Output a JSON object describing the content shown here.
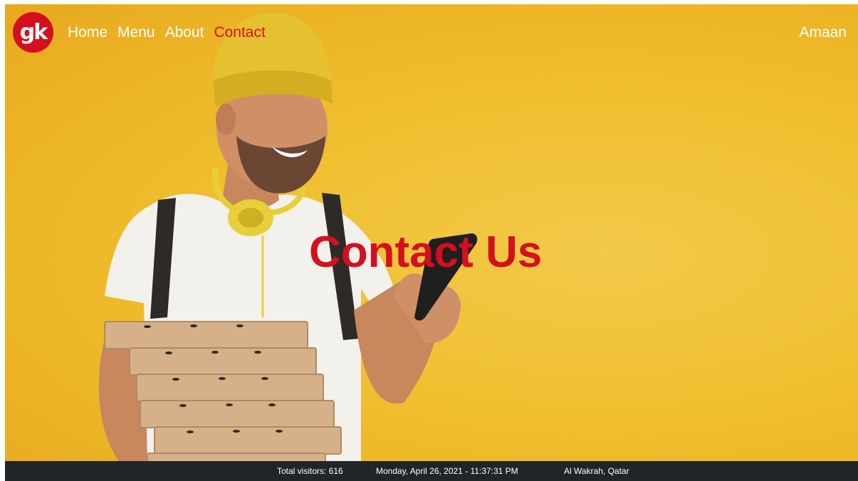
{
  "brand": {
    "logo_text": "gk",
    "logo_color": "#d4101e"
  },
  "nav": {
    "items": [
      {
        "label": "Home",
        "active": false
      },
      {
        "label": "Menu",
        "active": false
      },
      {
        "label": "About",
        "active": false
      },
      {
        "label": "Contact",
        "active": true
      }
    ],
    "user": "Amaan"
  },
  "hero": {
    "title": "Contact Us",
    "background_color": "#f0bf2f",
    "accent_color": "#d4101e"
  },
  "footer": {
    "visitors": "Total visitors: 616",
    "datetime": "Monday, April 26, 2021 - 11:37:31 PM",
    "location": "Al Wakrah, Qatar",
    "background_color": "#212529"
  }
}
